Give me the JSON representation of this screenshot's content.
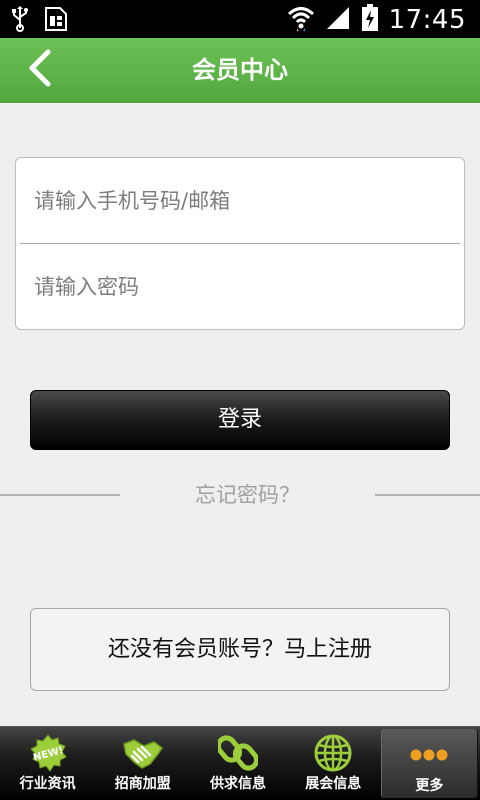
{
  "status_bar": {
    "time": "17:45",
    "icons": [
      "usb-icon",
      "sim-icon",
      "wifi-icon",
      "signal-icon",
      "battery-charging-icon"
    ]
  },
  "header": {
    "title": "会员中心",
    "back_icon": "chevron-left-icon",
    "color": "#5fb54a"
  },
  "login": {
    "account_placeholder": "请输入手机号码/邮箱",
    "password_placeholder": "请输入密码",
    "login_button": "登录",
    "forgot_password": "忘记密码？",
    "register_prompt": "还没有会员账号？马上注册"
  },
  "tabbar": {
    "items": [
      {
        "label": "行业资讯",
        "icon": "new-badge-icon"
      },
      {
        "label": "招商加盟",
        "icon": "handshake-icon"
      },
      {
        "label": "供求信息",
        "icon": "chain-link-icon"
      },
      {
        "label": "展会信息",
        "icon": "globe-icon"
      },
      {
        "label": "更多",
        "icon": "more-dots-icon"
      }
    ],
    "active_index": 4,
    "icon_color": "#9ccd3a"
  }
}
